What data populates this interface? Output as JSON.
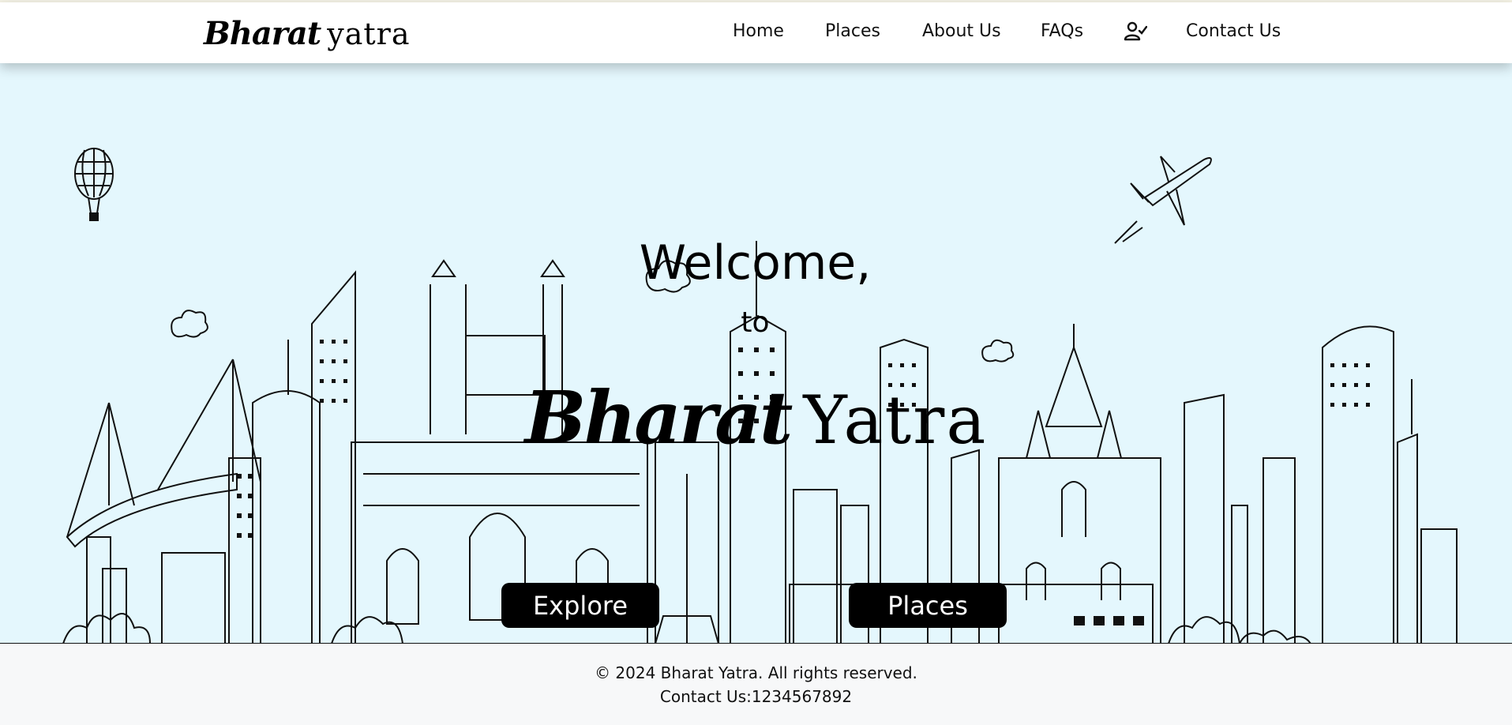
{
  "header": {
    "logo_bold": "Bharat",
    "logo_script": "yatra",
    "nav": [
      "Home",
      "Places",
      "About Us",
      "FAQs",
      "Contact Us"
    ],
    "user_icon": "user-check-icon"
  },
  "hero": {
    "welcome": "Welcome,",
    "to": "to",
    "brand_bold": "Bharat",
    "brand_script": "Yatra",
    "explore_label": "Explore",
    "places_label": "Places",
    "background": "#e4f7fd",
    "button_color": "#000000"
  },
  "footer": {
    "copyright": "© 2024 Bharat Yatra. All rights reserved.",
    "contact": "Contact Us:1234567892"
  }
}
